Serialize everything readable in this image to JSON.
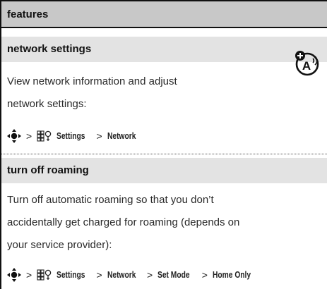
{
  "header": {
    "title": "features"
  },
  "sections": [
    {
      "heading": "network settings",
      "body_lines": [
        "View network information and adjust",
        "network settings:"
      ],
      "path": {
        "nav_icon": "nav-key-icon",
        "menu_icon": "settings-menu-icon",
        "steps": [
          "Settings",
          "Network"
        ],
        "separator": ">"
      },
      "badge_icon": "network-dependent-feature-icon",
      "badge_letter": "A"
    },
    {
      "heading": "turn off roaming",
      "body_lines": [
        "Turn off automatic roaming so that you don’t",
        "accidentally get charged for roaming (depends on",
        "your service provider):"
      ],
      "path": {
        "nav_icon": "nav-key-icon",
        "menu_icon": "settings-menu-icon",
        "steps": [
          "Settings",
          "Network",
          "Set Mode",
          "Home Only"
        ],
        "separator": ">"
      }
    }
  ]
}
